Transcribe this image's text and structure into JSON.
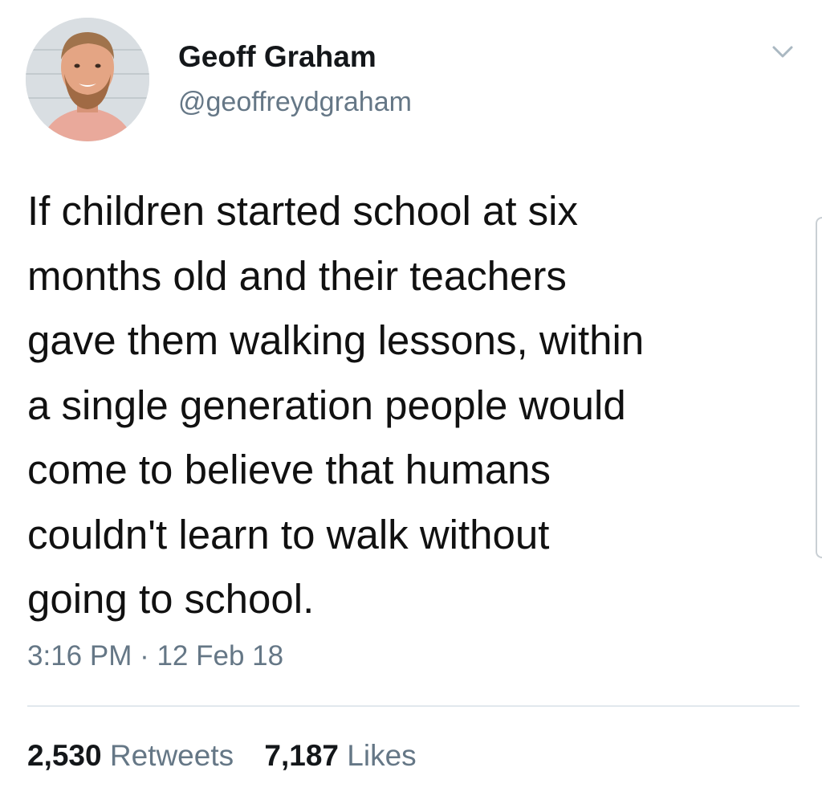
{
  "author": {
    "name": "Geoff Graham",
    "handle": "@geoffreydgraham"
  },
  "tweet": {
    "text": "If children started school at six\nmonths old and their teachers\ngave them walking lessons, within\na single generation people would\ncome to believe that humans\ncouldn't learn to walk without\ngoing to school.",
    "timestamp": "3:16 PM · 12 Feb 18"
  },
  "stats": {
    "retweets_count": "2,530",
    "retweets_label": "Retweets",
    "likes_count": "7,187",
    "likes_label": "Likes"
  },
  "icons": {
    "menu": "chevron-down-icon"
  },
  "colors": {
    "secondary_text": "#657786",
    "divider": "#e1e8ed"
  }
}
